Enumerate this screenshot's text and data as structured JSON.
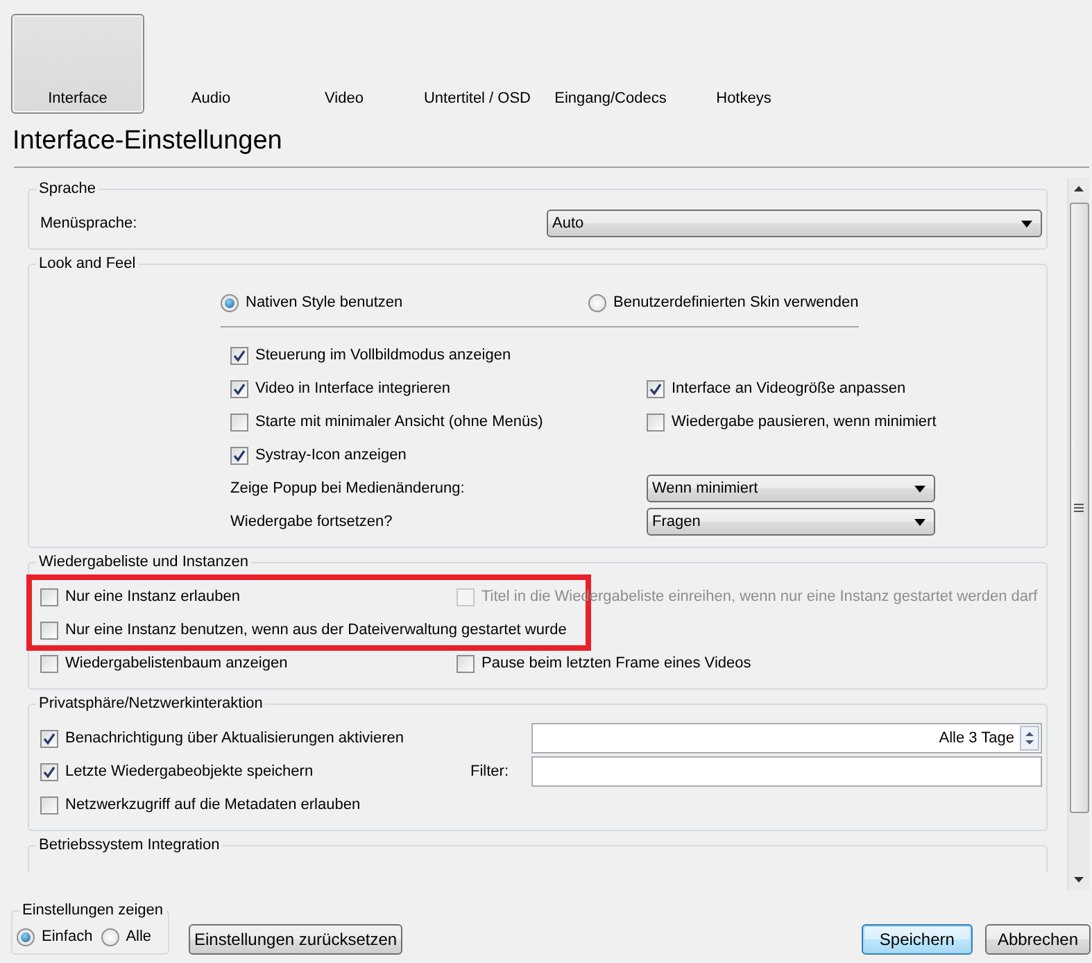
{
  "tabs": [
    {
      "label": "Interface",
      "selected": true
    },
    {
      "label": "Audio",
      "selected": false
    },
    {
      "label": "Video",
      "selected": false
    },
    {
      "label": "Untertitel / OSD",
      "selected": false
    },
    {
      "label": "Eingang/Codecs",
      "selected": false
    },
    {
      "label": "Hotkeys",
      "selected": false
    }
  ],
  "title": "Interface-Einstellungen",
  "sections": [
    {
      "kind": "language",
      "title": "Sprache",
      "rows": [
        {
          "kind": "options",
          "cells": [
            {
              "kind": "label",
              "text": "Menüsprache:"
            },
            {
              "kind": "select",
              "value": "Auto"
            }
          ]
        }
      ]
    },
    {
      "kind": "look",
      "title": "Look and Feel",
      "rows": [
        {
          "kind": "choice",
          "cells": [
            {
              "kind": "radio",
              "text": "Nativen Style benutzen",
              "selected": true
            },
            {
              "kind": "radio",
              "text": "Benutzerdefinierten Skin verwenden",
              "selected": false
            }
          ]
        },
        {
          "kind": "options",
          "cells": [
            {
              "kind": "checkbox",
              "text": "Steuerung im Vollbildmodus anzeigen",
              "checked": true
            }
          ]
        },
        {
          "kind": "options",
          "cells": [
            {
              "kind": "checkbox",
              "text": "Video in Interface integrieren",
              "checked": true
            },
            {
              "kind": "checkbox",
              "text": "Interface an Videogröße anpassen",
              "checked": true
            }
          ]
        },
        {
          "kind": "options",
          "cells": [
            {
              "kind": "checkbox",
              "text": "Starte mit minimaler Ansicht (ohne Menüs)",
              "checked": false
            },
            {
              "kind": "checkbox",
              "text": "Wiedergabe pausieren, wenn minimiert",
              "checked": false
            }
          ]
        },
        {
          "kind": "options",
          "cells": [
            {
              "kind": "checkbox",
              "text": "Systray-Icon anzeigen",
              "checked": true
            }
          ]
        },
        {
          "kind": "options",
          "cells": [
            {
              "kind": "label",
              "text": "Zeige Popup bei Medienänderung:"
            },
            {
              "kind": "select",
              "value": "Wenn minimiert"
            }
          ]
        },
        {
          "kind": "options",
          "cells": [
            {
              "kind": "label",
              "text": "Wiedergabe fortsetzen?"
            },
            {
              "kind": "select",
              "value": "Fragen"
            }
          ]
        }
      ]
    },
    {
      "kind": "playlist",
      "title": "Wiedergabeliste und Instanzen",
      "rows": [
        {
          "kind": "options",
          "highlighted": true,
          "cells": [
            {
              "kind": "checkbox",
              "text": "Nur eine Instanz erlauben",
              "checked": false
            },
            {
              "kind": "checkbox",
              "text": "Titel in die Wiedergabeliste einreihen, wenn nur eine Instanz gestartet werden darf",
              "checked": false,
              "disabled": true
            }
          ]
        },
        {
          "kind": "options",
          "highlighted": true,
          "cells": [
            {
              "kind": "checkbox",
              "text": "Nur eine Instanz benutzen, wenn aus der Dateiverwaltung gestartet wurde",
              "checked": false
            }
          ]
        },
        {
          "kind": "options",
          "cells": [
            {
              "kind": "checkbox",
              "text": "Wiedergabelistenbaum anzeigen",
              "checked": false
            },
            {
              "kind": "checkbox",
              "text": "Pause beim letzten Frame eines Videos",
              "checked": false
            }
          ]
        }
      ]
    },
    {
      "kind": "privacy",
      "title": "Privatsphäre/Netzwerkinteraktion",
      "rows": [
        {
          "kind": "options",
          "cells": [
            {
              "kind": "checkbox",
              "text": "Benachrichtigung über Aktualisierungen aktivieren",
              "checked": true
            },
            {
              "kind": "spin",
              "value": "Alle 3 Tage"
            }
          ]
        },
        {
          "kind": "options",
          "cells": [
            {
              "kind": "checkbox",
              "text": "Letzte Wiedergabeobjekte speichern",
              "checked": true
            },
            {
              "kind": "label",
              "text": "Filter:"
            },
            {
              "kind": "field"
            }
          ]
        },
        {
          "kind": "options",
          "cells": [
            {
              "kind": "checkbox",
              "text": "Netzwerkzugriff auf die Metadaten erlauben",
              "checked": false
            }
          ]
        }
      ]
    },
    {
      "kind": "os",
      "title": "Betriebssystem Integration"
    }
  ],
  "show_settings": {
    "title": "Einstellungen zeigen",
    "options": [
      {
        "label": "Einfach",
        "selected": true
      },
      {
        "label": "Alle",
        "selected": false
      }
    ]
  },
  "buttons": [
    {
      "kind": "reset",
      "label": "Einstellungen zurücksetzen"
    },
    {
      "kind": "default",
      "label": "Speichern"
    },
    {
      "kind": "normal",
      "label": "Abbrechen"
    }
  ]
}
